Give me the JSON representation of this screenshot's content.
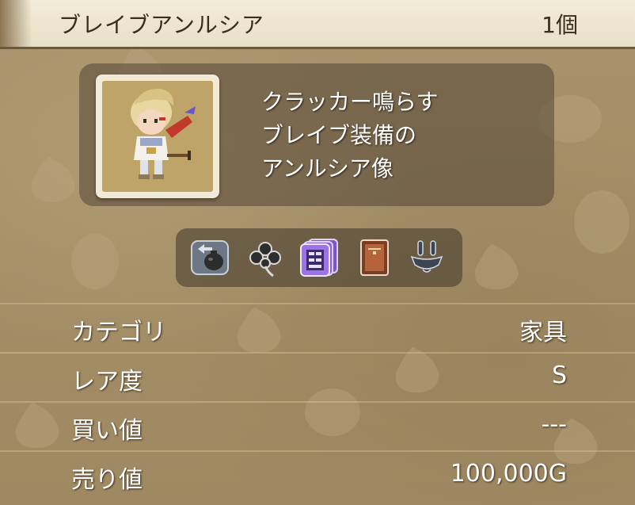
{
  "header": {
    "item_name": "ブレイブアンルシア",
    "count": "1個"
  },
  "description": "クラッカー鳴らす\nブレイブ装備の\nアンルシア像",
  "icons": [
    {
      "name": "bag-icon"
    },
    {
      "name": "clover-icon"
    },
    {
      "name": "furniture-cards-icon"
    },
    {
      "name": "brown-book-icon"
    },
    {
      "name": "tongs-icon"
    }
  ],
  "stats": [
    {
      "label": "カテゴリ",
      "value": "家具"
    },
    {
      "label": "レア度",
      "value": "S"
    },
    {
      "label": "買い値",
      "value": "---"
    },
    {
      "label": "売り値",
      "value": "100,000G"
    }
  ],
  "colors": {
    "header_bg": "#f3ecd9",
    "header_text": "#3a2d1c",
    "panel_bg": "#52463a",
    "text_white": "#ffffff"
  }
}
